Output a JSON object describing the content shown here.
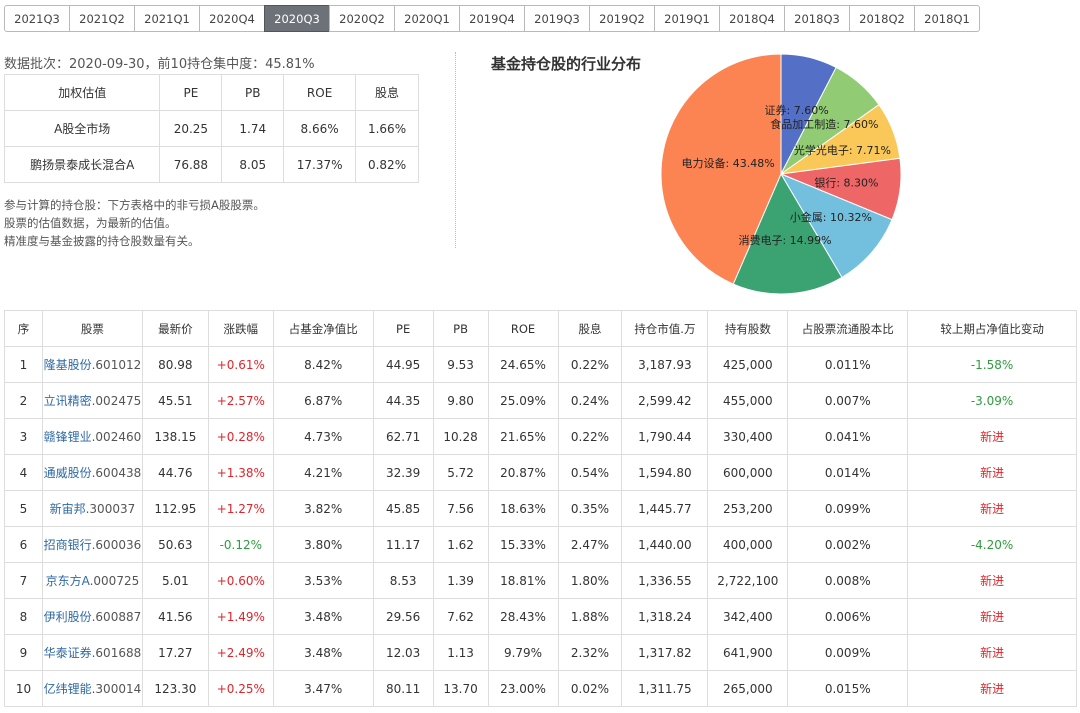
{
  "period_tabs": [
    "2021Q3",
    "2021Q2",
    "2021Q1",
    "2020Q4",
    "2020Q3",
    "2020Q2",
    "2020Q1",
    "2019Q4",
    "2019Q3",
    "2019Q2",
    "2019Q1",
    "2018Q4",
    "2018Q3",
    "2018Q2",
    "2018Q1"
  ],
  "active_tab": "2020Q3",
  "batch_info": "数据批次：2020-09-30，前10持仓集中度：45.81%",
  "valuation": {
    "headers": [
      "加权估值",
      "PE",
      "PB",
      "ROE",
      "股息"
    ],
    "rows": [
      [
        "A股全市场",
        "20.25",
        "1.74",
        "8.66%",
        "1.66%"
      ],
      [
        "鹏扬景泰成长混合A",
        "76.88",
        "8.05",
        "17.37%",
        "0.82%"
      ]
    ]
  },
  "notes": [
    "参与计算的持仓股：下方表格中的非亏损A股股票。",
    "股票的估值数据，为最新的估值。",
    "精准度与基金披露的持仓股数量有关。"
  ],
  "pie_title": "基金持仓股的行业分布",
  "colors": {
    "accent_blue": "#2f6aa3",
    "up_red": "#e0252b",
    "down_green": "#2f9b3f",
    "tab_active_bg": "#6d7278"
  },
  "chart_data": {
    "type": "pie",
    "title": "基金持仓股的行业分布",
    "slices": [
      {
        "label": "证券",
        "value": 7.6,
        "text": "证券: 7.60%",
        "color": "#5470c6"
      },
      {
        "label": "食品加工制造",
        "value": 7.6,
        "text": "食品加工制造: 7.60%",
        "color": "#91cc75"
      },
      {
        "label": "光学光电子",
        "value": 7.71,
        "text": "光学光电子: 7.71%",
        "color": "#fac858"
      },
      {
        "label": "银行",
        "value": 8.3,
        "text": "银行: 8.30%",
        "color": "#ee6666"
      },
      {
        "label": "小金属",
        "value": 10.32,
        "text": "小金属: 10.32%",
        "color": "#73c0de"
      },
      {
        "label": "消费电子",
        "value": 14.99,
        "text": "消费电子: 14.99%",
        "color": "#3ba272"
      },
      {
        "label": "电力设备",
        "value": 43.48,
        "text": "电力设备: 43.48%",
        "color": "#fc8452"
      }
    ]
  },
  "holdings": {
    "headers": [
      "序",
      "股票",
      "最新价",
      "涨跌幅",
      "占基金净值比",
      "PE",
      "PB",
      "ROE",
      "股息",
      "持仓市值.万",
      "持有股数",
      "占股票流通股本比",
      "较上期占净值比变动"
    ],
    "rows": [
      {
        "idx": "1",
        "name": "隆基股份",
        "code": ".601012",
        "price": "80.98",
        "chg": "+0.61%",
        "chg_dir": "up",
        "nav": "8.42%",
        "pe": "44.95",
        "pb": "9.53",
        "roe": "24.65%",
        "div": "0.22%",
        "mv": "3,187.93",
        "shares": "425,000",
        "float": "0.011%",
        "delta": "-1.58%",
        "delta_dir": "down"
      },
      {
        "idx": "2",
        "name": "立讯精密",
        "code": ".002475",
        "price": "45.51",
        "chg": "+2.57%",
        "chg_dir": "up",
        "nav": "6.87%",
        "pe": "44.35",
        "pb": "9.80",
        "roe": "25.09%",
        "div": "0.24%",
        "mv": "2,599.42",
        "shares": "455,000",
        "float": "0.007%",
        "delta": "-3.09%",
        "delta_dir": "down"
      },
      {
        "idx": "3",
        "name": "赣锋锂业",
        "code": ".002460",
        "price": "138.15",
        "chg": "+0.28%",
        "chg_dir": "up",
        "nav": "4.73%",
        "pe": "62.71",
        "pb": "10.28",
        "roe": "21.65%",
        "div": "0.22%",
        "mv": "1,790.44",
        "shares": "330,400",
        "float": "0.041%",
        "delta": "新进",
        "delta_dir": "new"
      },
      {
        "idx": "4",
        "name": "通威股份",
        "code": ".600438",
        "price": "44.76",
        "chg": "+1.38%",
        "chg_dir": "up",
        "nav": "4.21%",
        "pe": "32.39",
        "pb": "5.72",
        "roe": "20.87%",
        "div": "0.54%",
        "mv": "1,594.80",
        "shares": "600,000",
        "float": "0.014%",
        "delta": "新进",
        "delta_dir": "new"
      },
      {
        "idx": "5",
        "name": "新宙邦",
        "code": ".300037",
        "price": "112.95",
        "chg": "+1.27%",
        "chg_dir": "up",
        "nav": "3.82%",
        "pe": "45.85",
        "pb": "7.56",
        "roe": "18.63%",
        "div": "0.35%",
        "mv": "1,445.77",
        "shares": "253,200",
        "float": "0.099%",
        "delta": "新进",
        "delta_dir": "new"
      },
      {
        "idx": "6",
        "name": "招商银行",
        "code": ".600036",
        "price": "50.63",
        "chg": "-0.12%",
        "chg_dir": "down",
        "nav": "3.80%",
        "pe": "11.17",
        "pb": "1.62",
        "roe": "15.33%",
        "div": "2.47%",
        "mv": "1,440.00",
        "shares": "400,000",
        "float": "0.002%",
        "delta": "-4.20%",
        "delta_dir": "down"
      },
      {
        "idx": "7",
        "name": "京东方A",
        "code": ".000725",
        "price": "5.01",
        "chg": "+0.60%",
        "chg_dir": "up",
        "nav": "3.53%",
        "pe": "8.53",
        "pb": "1.39",
        "roe": "18.81%",
        "div": "1.80%",
        "mv": "1,336.55",
        "shares": "2,722,100",
        "float": "0.008%",
        "delta": "新进",
        "delta_dir": "new"
      },
      {
        "idx": "8",
        "name": "伊利股份",
        "code": ".600887",
        "price": "41.56",
        "chg": "+1.49%",
        "chg_dir": "up",
        "nav": "3.48%",
        "pe": "29.56",
        "pb": "7.62",
        "roe": "28.43%",
        "div": "1.88%",
        "mv": "1,318.24",
        "shares": "342,400",
        "float": "0.006%",
        "delta": "新进",
        "delta_dir": "new"
      },
      {
        "idx": "9",
        "name": "华泰证券",
        "code": ".601688",
        "price": "17.27",
        "chg": "+2.49%",
        "chg_dir": "up",
        "nav": "3.48%",
        "pe": "12.03",
        "pb": "1.13",
        "roe": "9.79%",
        "div": "2.32%",
        "mv": "1,317.82",
        "shares": "641,900",
        "float": "0.009%",
        "delta": "新进",
        "delta_dir": "new"
      },
      {
        "idx": "10",
        "name": "亿纬锂能",
        "code": ".300014",
        "price": "123.30",
        "chg": "+0.25%",
        "chg_dir": "up",
        "nav": "3.47%",
        "pe": "80.11",
        "pb": "13.70",
        "roe": "23.00%",
        "div": "0.02%",
        "mv": "1,311.75",
        "shares": "265,000",
        "float": "0.015%",
        "delta": "新进",
        "delta_dir": "new"
      }
    ]
  }
}
